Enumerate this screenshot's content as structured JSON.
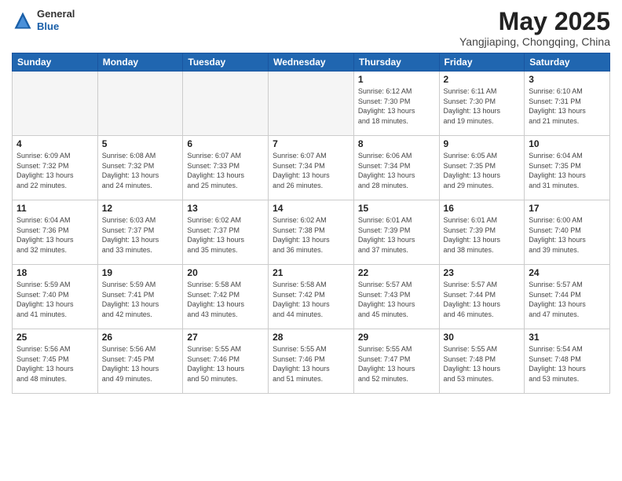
{
  "header": {
    "logo_general": "General",
    "logo_blue": "Blue",
    "month_title": "May 2025",
    "location": "Yangjiaping, Chongqing, China"
  },
  "weekdays": [
    "Sunday",
    "Monday",
    "Tuesday",
    "Wednesday",
    "Thursday",
    "Friday",
    "Saturday"
  ],
  "weeks": [
    [
      {
        "day": "",
        "info": ""
      },
      {
        "day": "",
        "info": ""
      },
      {
        "day": "",
        "info": ""
      },
      {
        "day": "",
        "info": ""
      },
      {
        "day": "1",
        "info": "Sunrise: 6:12 AM\nSunset: 7:30 PM\nDaylight: 13 hours\nand 18 minutes."
      },
      {
        "day": "2",
        "info": "Sunrise: 6:11 AM\nSunset: 7:30 PM\nDaylight: 13 hours\nand 19 minutes."
      },
      {
        "day": "3",
        "info": "Sunrise: 6:10 AM\nSunset: 7:31 PM\nDaylight: 13 hours\nand 21 minutes."
      }
    ],
    [
      {
        "day": "4",
        "info": "Sunrise: 6:09 AM\nSunset: 7:32 PM\nDaylight: 13 hours\nand 22 minutes."
      },
      {
        "day": "5",
        "info": "Sunrise: 6:08 AM\nSunset: 7:32 PM\nDaylight: 13 hours\nand 24 minutes."
      },
      {
        "day": "6",
        "info": "Sunrise: 6:07 AM\nSunset: 7:33 PM\nDaylight: 13 hours\nand 25 minutes."
      },
      {
        "day": "7",
        "info": "Sunrise: 6:07 AM\nSunset: 7:34 PM\nDaylight: 13 hours\nand 26 minutes."
      },
      {
        "day": "8",
        "info": "Sunrise: 6:06 AM\nSunset: 7:34 PM\nDaylight: 13 hours\nand 28 minutes."
      },
      {
        "day": "9",
        "info": "Sunrise: 6:05 AM\nSunset: 7:35 PM\nDaylight: 13 hours\nand 29 minutes."
      },
      {
        "day": "10",
        "info": "Sunrise: 6:04 AM\nSunset: 7:35 PM\nDaylight: 13 hours\nand 31 minutes."
      }
    ],
    [
      {
        "day": "11",
        "info": "Sunrise: 6:04 AM\nSunset: 7:36 PM\nDaylight: 13 hours\nand 32 minutes."
      },
      {
        "day": "12",
        "info": "Sunrise: 6:03 AM\nSunset: 7:37 PM\nDaylight: 13 hours\nand 33 minutes."
      },
      {
        "day": "13",
        "info": "Sunrise: 6:02 AM\nSunset: 7:37 PM\nDaylight: 13 hours\nand 35 minutes."
      },
      {
        "day": "14",
        "info": "Sunrise: 6:02 AM\nSunset: 7:38 PM\nDaylight: 13 hours\nand 36 minutes."
      },
      {
        "day": "15",
        "info": "Sunrise: 6:01 AM\nSunset: 7:39 PM\nDaylight: 13 hours\nand 37 minutes."
      },
      {
        "day": "16",
        "info": "Sunrise: 6:01 AM\nSunset: 7:39 PM\nDaylight: 13 hours\nand 38 minutes."
      },
      {
        "day": "17",
        "info": "Sunrise: 6:00 AM\nSunset: 7:40 PM\nDaylight: 13 hours\nand 39 minutes."
      }
    ],
    [
      {
        "day": "18",
        "info": "Sunrise: 5:59 AM\nSunset: 7:40 PM\nDaylight: 13 hours\nand 41 minutes."
      },
      {
        "day": "19",
        "info": "Sunrise: 5:59 AM\nSunset: 7:41 PM\nDaylight: 13 hours\nand 42 minutes."
      },
      {
        "day": "20",
        "info": "Sunrise: 5:58 AM\nSunset: 7:42 PM\nDaylight: 13 hours\nand 43 minutes."
      },
      {
        "day": "21",
        "info": "Sunrise: 5:58 AM\nSunset: 7:42 PM\nDaylight: 13 hours\nand 44 minutes."
      },
      {
        "day": "22",
        "info": "Sunrise: 5:57 AM\nSunset: 7:43 PM\nDaylight: 13 hours\nand 45 minutes."
      },
      {
        "day": "23",
        "info": "Sunrise: 5:57 AM\nSunset: 7:44 PM\nDaylight: 13 hours\nand 46 minutes."
      },
      {
        "day": "24",
        "info": "Sunrise: 5:57 AM\nSunset: 7:44 PM\nDaylight: 13 hours\nand 47 minutes."
      }
    ],
    [
      {
        "day": "25",
        "info": "Sunrise: 5:56 AM\nSunset: 7:45 PM\nDaylight: 13 hours\nand 48 minutes."
      },
      {
        "day": "26",
        "info": "Sunrise: 5:56 AM\nSunset: 7:45 PM\nDaylight: 13 hours\nand 49 minutes."
      },
      {
        "day": "27",
        "info": "Sunrise: 5:55 AM\nSunset: 7:46 PM\nDaylight: 13 hours\nand 50 minutes."
      },
      {
        "day": "28",
        "info": "Sunrise: 5:55 AM\nSunset: 7:46 PM\nDaylight: 13 hours\nand 51 minutes."
      },
      {
        "day": "29",
        "info": "Sunrise: 5:55 AM\nSunset: 7:47 PM\nDaylight: 13 hours\nand 52 minutes."
      },
      {
        "day": "30",
        "info": "Sunrise: 5:55 AM\nSunset: 7:48 PM\nDaylight: 13 hours\nand 53 minutes."
      },
      {
        "day": "31",
        "info": "Sunrise: 5:54 AM\nSunset: 7:48 PM\nDaylight: 13 hours\nand 53 minutes."
      }
    ]
  ]
}
